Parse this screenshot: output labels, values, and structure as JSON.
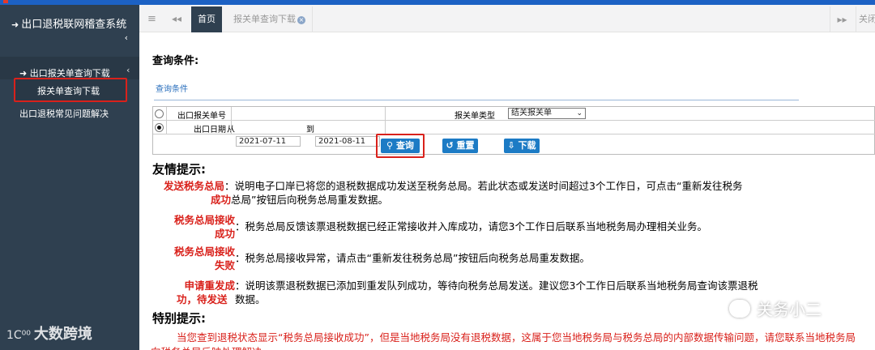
{
  "colors": {
    "accent": "#1c7bc5",
    "sidebar": "#2f4050",
    "highlight": "#d9211b"
  },
  "sidebar": {
    "title_icon": "sign-in-icon",
    "title": "出口退税联网稽查系统",
    "chevron": "‹",
    "submenu": {
      "label": "出口报关单查询下载",
      "chevron": "‹"
    },
    "active_item": "报关单查询下载",
    "item2": "出口退税常见问题解决"
  },
  "tabs": {
    "menu_glyph": "≡",
    "back_glyph": "◂◂",
    "home": "首页",
    "query": "报关单查询下载",
    "close_glyph": "×",
    "forward_glyph": "▸▸",
    "close": "关闭"
  },
  "query": {
    "heading": "查询条件:",
    "legend": "查询条件",
    "row1": {
      "label": "出口报关单号",
      "type_label": "报关单类型",
      "type_value": "结关报关单",
      "radio_selected": false
    },
    "row2": {
      "label": "出口日期",
      "from_label": "从",
      "from": "2021-07-11",
      "to_label": "到",
      "to": "2021-08-11",
      "radio_selected": true
    },
    "buttons": {
      "search": "查询",
      "reset": "重置",
      "download": "下载"
    },
    "icons": {
      "search": "search-icon",
      "reset": "undo-icon",
      "download": "download-icon"
    }
  },
  "tips": {
    "heading": "友情提示:",
    "t1_key_a": "发送税务总局",
    "t1_key_b": "成功",
    "t1_text_a": "：说明电子口岸已将您的退税数据成功发送至税务总局。若此状态或发送时间超过3个工作日，可点击“重新发往税务",
    "t1_text_b": "总局”按钮后向税务总局重发数据。",
    "t2_key_a": "税务总局接收",
    "t2_key_b": "成功",
    "t2_text": "：税务总局反馈该票退税数据已经正常接收并入库成功，请您3个工作日后联系当地税务局办理相关业务。",
    "t3_key_a": "税务总局接收",
    "t3_key_b": "失败",
    "t3_text": "：税务总局接收异常，请点击“重新发往税务总局”按钮后向税务总局重发数据。",
    "t4_key_a": "申请重发成",
    "t4_key_b": "功，待发送",
    "t4_text_a": "：说明该票退税数据已添加到重发队列成功，等待向税务总局发送。建议您3个工作日后联系当地税务局查询该票退税",
    "t4_text_b": "数据。"
  },
  "special": {
    "heading": "特别提示:",
    "text": "当您查到退税状态显示“税务总局接收成功”，但是当地税务局没有退税数据，这属于您当地税务局与税务总局的内部数据传输问题，请您联系当地税务局向税务总局反映处理解决。"
  },
  "watermarks": {
    "left_logo": "1C⁰⁰",
    "left": "大数跨境",
    "right_icon": "wechat-icon",
    "right": "关务小二"
  }
}
